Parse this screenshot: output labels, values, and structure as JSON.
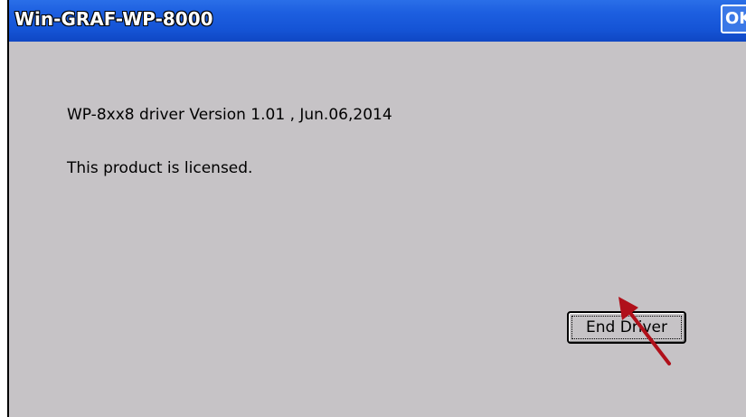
{
  "window": {
    "title": "Win-GRAF-WP-8000",
    "ok_label": "OK"
  },
  "content": {
    "version_line": "WP-8xx8 driver Version 1.01 , Jun.06,2014",
    "license_line": "This product is licensed."
  },
  "buttons": {
    "end_driver_label": "End Driver"
  },
  "annotation": {
    "arrow_icon": "red-arrow-icon",
    "arrow_color": "#b0101a"
  },
  "colors": {
    "titlebar": "#1d5fe0",
    "window_background": "#c6c3c6"
  }
}
